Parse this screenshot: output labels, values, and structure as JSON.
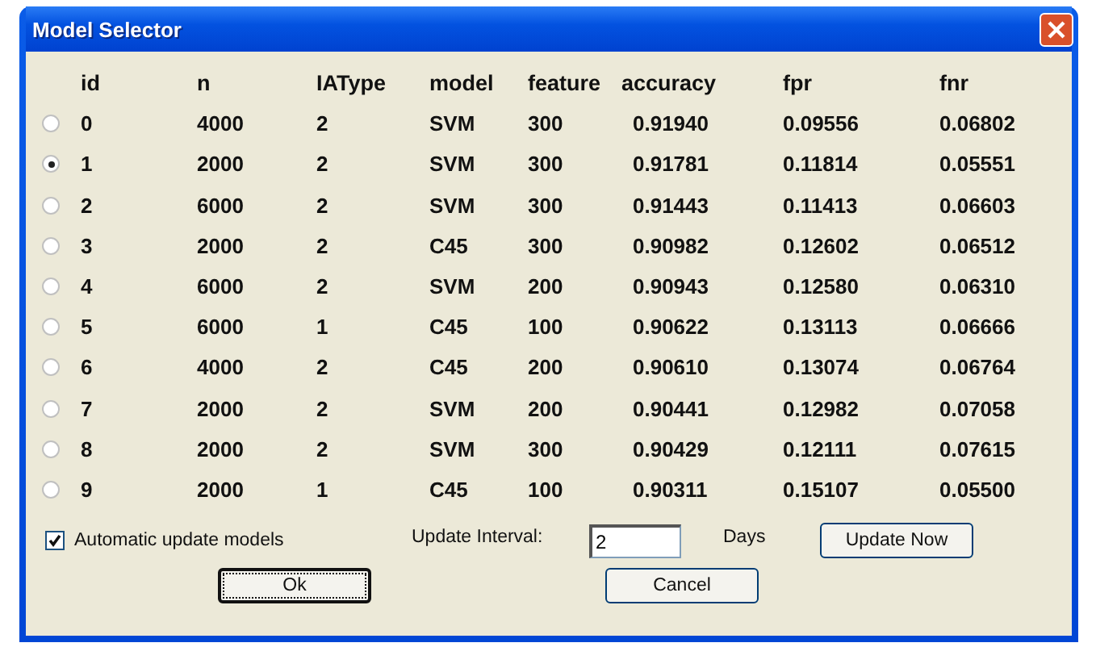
{
  "window": {
    "title": "Model Selector"
  },
  "table": {
    "columns": [
      "id",
      "n",
      "IAType",
      "model",
      "feature",
      "accuracy",
      "fpr",
      "fnr"
    ],
    "rows": [
      {
        "selected": false,
        "cells": [
          "0",
          "4000",
          "2",
          "SVM",
          "300",
          "0.91940",
          "0.09556",
          "0.06802"
        ]
      },
      {
        "selected": true,
        "cells": [
          "1",
          "2000",
          "2",
          "SVM",
          "300",
          "0.91781",
          "0.11814",
          "0.05551"
        ]
      },
      {
        "selected": false,
        "cells": [
          "2",
          "6000",
          "2",
          "SVM",
          "300",
          "0.91443",
          "0.11413",
          "0.06603"
        ]
      },
      {
        "selected": false,
        "cells": [
          "3",
          "2000",
          "2",
          "C45",
          "300",
          "0.90982",
          "0.12602",
          "0.06512"
        ]
      },
      {
        "selected": false,
        "cells": [
          "4",
          "6000",
          "2",
          "SVM",
          "200",
          "0.90943",
          "0.12580",
          "0.06310"
        ]
      },
      {
        "selected": false,
        "cells": [
          "5",
          "6000",
          "1",
          "C45",
          "100",
          "0.90622",
          "0.13113",
          "0.06666"
        ]
      },
      {
        "selected": false,
        "cells": [
          "6",
          "4000",
          "2",
          "C45",
          "200",
          "0.90610",
          "0.13074",
          "0.06764"
        ]
      },
      {
        "selected": false,
        "cells": [
          "7",
          "2000",
          "2",
          "SVM",
          "200",
          "0.90441",
          "0.12982",
          "0.07058"
        ]
      },
      {
        "selected": false,
        "cells": [
          "8",
          "2000",
          "2",
          "SVM",
          "300",
          "0.90429",
          "0.12111",
          "0.07615"
        ]
      },
      {
        "selected": false,
        "cells": [
          "9",
          "2000",
          "1",
          "C45",
          "100",
          "0.90311",
          "0.15107",
          "0.05500"
        ]
      }
    ]
  },
  "auto_update": {
    "label": "Automatic update models",
    "checked": true
  },
  "interval": {
    "label": "Update Interval:",
    "value": "2",
    "unit": "Days"
  },
  "buttons": [
    {
      "label": "Update Now",
      "focused": false
    },
    {
      "label": "Ok",
      "focused": true
    },
    {
      "label": "Cancel",
      "focused": false
    }
  ]
}
